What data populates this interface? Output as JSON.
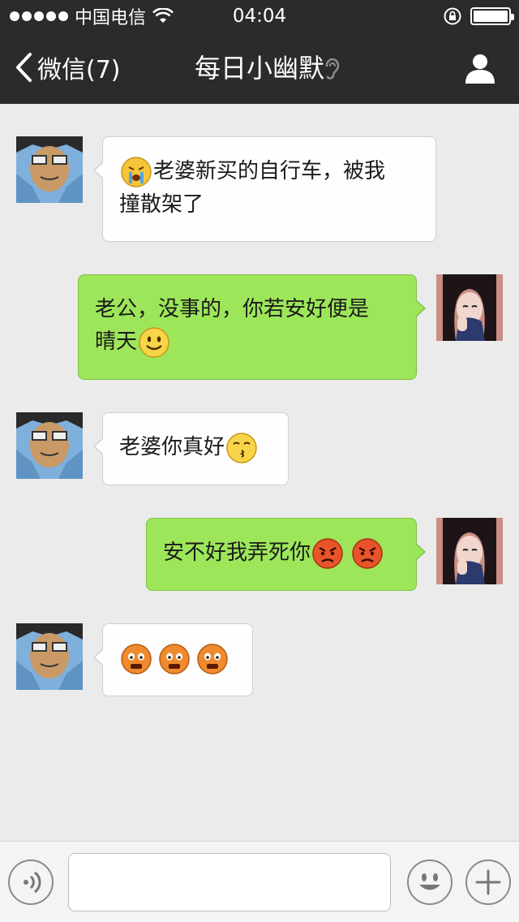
{
  "status_bar": {
    "carrier": "中国电信",
    "time": "04:04"
  },
  "nav": {
    "back_label": "微信(7)",
    "title": "每日小幽默"
  },
  "colors": {
    "bar_bg": "#2b2b2e",
    "chat_bg": "#ebebeb",
    "bubble_out": "#9de65a",
    "bubble_in": "#fefefe"
  },
  "messages": [
    {
      "side": "in",
      "avatar": "cartoon-avatar",
      "text_line1": "老婆新买的自行车，被我",
      "text_line2": "撞散架了",
      "emoji": [
        "crying-face"
      ]
    },
    {
      "side": "out",
      "avatar": "girl-avatar",
      "text_line1": "老公，没事的，你若安好便是",
      "text_line2": "晴天",
      "emoji": [
        "smile-face"
      ]
    },
    {
      "side": "in",
      "avatar": "cartoon-avatar",
      "text": "老婆你真好",
      "emoji": [
        "kiss-face"
      ]
    },
    {
      "side": "out",
      "avatar": "girl-avatar",
      "text": "安不好我弄死你",
      "emoji": [
        "angry-face",
        "angry-face"
      ]
    },
    {
      "side": "in",
      "avatar": "cartoon-avatar",
      "text": "",
      "emoji": [
        "scared-face",
        "scared-face",
        "scared-face"
      ]
    }
  ],
  "input_bar": {
    "placeholder": ""
  }
}
